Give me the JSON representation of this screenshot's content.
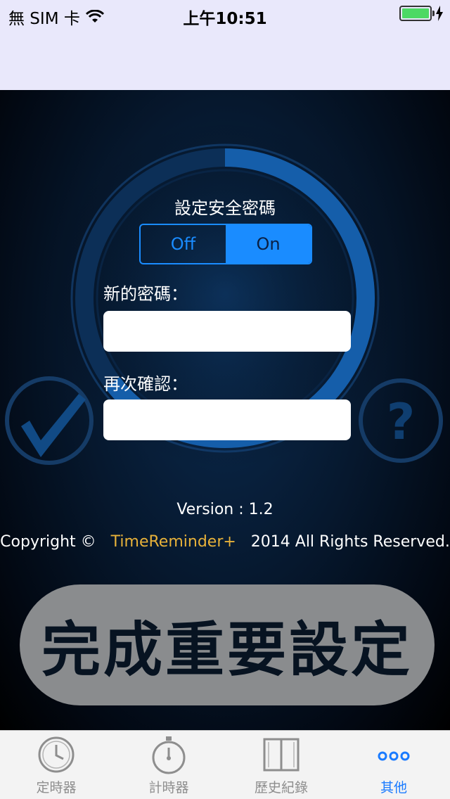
{
  "status_bar": {
    "carrier": "無 SIM 卡",
    "time": "上午10:51",
    "battery_level": 1.0
  },
  "settings": {
    "title": "設定安全密碼",
    "toggle": {
      "off_label": "Off",
      "on_label": "On",
      "selected": "On"
    },
    "new_password_label": "新的密碼：",
    "confirm_password_label": "再次確認：",
    "new_password_value": "",
    "confirm_password_value": ""
  },
  "info": {
    "version": "Version : 1.2",
    "copyright_prefix": "Copyright ©",
    "brand": "TimeReminder+",
    "copyright_suffix": "2014 All Rights Reserved."
  },
  "actions": {
    "complete_label": "完成重要設定"
  },
  "tab_bar": {
    "items": [
      {
        "label": "定時器",
        "icon": "clock-icon",
        "active": false
      },
      {
        "label": "計時器",
        "icon": "stopwatch-icon",
        "active": false
      },
      {
        "label": "歷史紀錄",
        "icon": "book-icon",
        "active": false
      },
      {
        "label": "其他",
        "icon": "more-dots-icon",
        "active": true
      }
    ]
  },
  "colors": {
    "accent": "#1a8cff",
    "brand": "#e8b23a",
    "tab_active": "#1a7bff",
    "tab_inactive": "#8e8e8e"
  }
}
